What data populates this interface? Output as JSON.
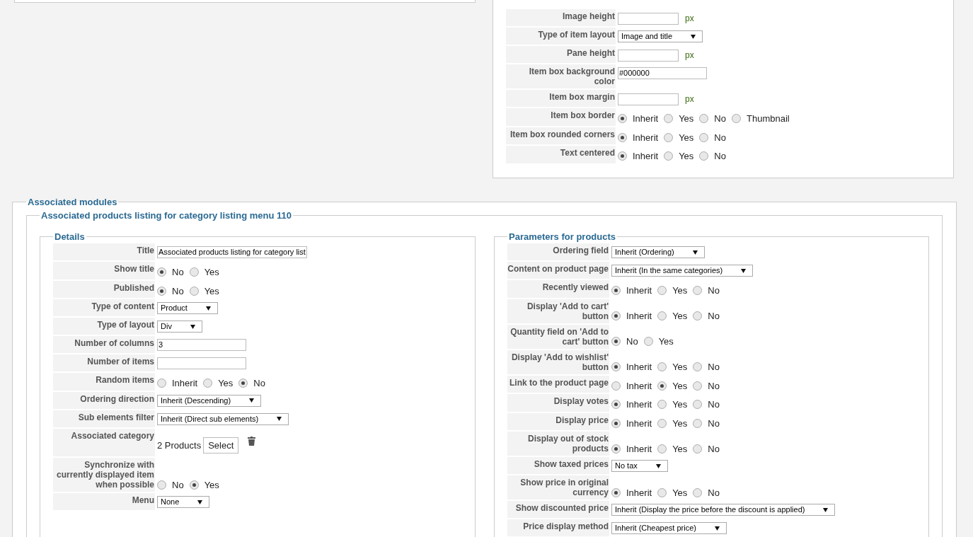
{
  "top_panel": {
    "rows": [
      {
        "kind": "text",
        "label": "Image height",
        "value": "",
        "unit": "px"
      },
      {
        "kind": "select",
        "label": "Type of item layout",
        "value": "Image and title"
      },
      {
        "kind": "text",
        "label": "Pane height",
        "value": "",
        "unit": "px"
      },
      {
        "kind": "text",
        "label": "Item box background color",
        "value": "#000000"
      },
      {
        "kind": "text",
        "label": "Item box margin",
        "value": "",
        "unit": "px"
      },
      {
        "kind": "radio",
        "label": "Item box border",
        "options": [
          {
            "label": "Inherit",
            "selected": true
          },
          {
            "label": "Yes",
            "selected": false
          },
          {
            "label": "No",
            "selected": false
          },
          {
            "label": "Thumbnail",
            "selected": false
          }
        ]
      },
      {
        "kind": "radio",
        "label": "Item box rounded corners",
        "options": [
          {
            "label": "Inherit",
            "selected": true
          },
          {
            "label": "Yes",
            "selected": false
          },
          {
            "label": "No",
            "selected": false
          }
        ]
      },
      {
        "kind": "radio",
        "label": "Text centered",
        "options": [
          {
            "label": "Inherit",
            "selected": true
          },
          {
            "label": "Yes",
            "selected": false
          },
          {
            "label": "No",
            "selected": false
          }
        ]
      }
    ]
  },
  "associated_modules": {
    "legend": "Associated modules",
    "module": {
      "legend": "Associated products listing for category listing menu 110",
      "details": {
        "legend": "Details",
        "rows": [
          {
            "kind": "text",
            "label": "Title",
            "value": "Associated products listing for category list"
          },
          {
            "kind": "radio",
            "label": "Show title",
            "options": [
              {
                "label": "No",
                "selected": true
              },
              {
                "label": "Yes",
                "selected": false
              }
            ]
          },
          {
            "kind": "radio",
            "label": "Published",
            "options": [
              {
                "label": "No",
                "selected": true
              },
              {
                "label": "Yes",
                "selected": false
              }
            ]
          },
          {
            "kind": "select",
            "label": "Type of content",
            "value": "Product"
          },
          {
            "kind": "select",
            "label": "Type of layout",
            "value": "Div"
          },
          {
            "kind": "text",
            "label": "Number of columns",
            "value": "3"
          },
          {
            "kind": "text",
            "label": "Number of items",
            "value": ""
          },
          {
            "kind": "radio",
            "label": "Random items",
            "options": [
              {
                "label": "Inherit",
                "selected": false
              },
              {
                "label": "Yes",
                "selected": false
              },
              {
                "label": "No",
                "selected": true
              }
            ]
          },
          {
            "kind": "select",
            "label": "Ordering direction",
            "value": "Inherit (Descending)"
          },
          {
            "kind": "select",
            "label": "Sub elements filter",
            "value": "Inherit (Direct sub elements)"
          },
          {
            "kind": "category",
            "label": "Associated category",
            "count": "2 Products",
            "button": "Select"
          },
          {
            "kind": "radio",
            "label": "Synchronize with currently displayed item when possible",
            "options": [
              {
                "label": "No",
                "selected": false
              },
              {
                "label": "Yes",
                "selected": true
              }
            ]
          },
          {
            "kind": "select",
            "label": "Menu",
            "value": "None"
          }
        ]
      },
      "parameters": {
        "legend": "Parameters for products",
        "rows": [
          {
            "kind": "select",
            "label": "Ordering field",
            "value": "Inherit (Ordering)"
          },
          {
            "kind": "select",
            "label": "Content on product page",
            "value": "Inherit (In the same categories)"
          },
          {
            "kind": "radio",
            "label": "Recently viewed",
            "options": [
              {
                "label": "Inherit",
                "selected": true
              },
              {
                "label": "Yes",
                "selected": false
              },
              {
                "label": "No",
                "selected": false
              }
            ]
          },
          {
            "kind": "radio",
            "label": "Display 'Add to cart' button",
            "options": [
              {
                "label": "Inherit",
                "selected": true
              },
              {
                "label": "Yes",
                "selected": false
              },
              {
                "label": "No",
                "selected": false
              }
            ]
          },
          {
            "kind": "radio",
            "label": "Quantity field on 'Add to cart' button",
            "options": [
              {
                "label": "No",
                "selected": true
              },
              {
                "label": "Yes",
                "selected": false
              }
            ]
          },
          {
            "kind": "radio",
            "label": "Display 'Add to wishlist' button",
            "options": [
              {
                "label": "Inherit",
                "selected": true
              },
              {
                "label": "Yes",
                "selected": false
              },
              {
                "label": "No",
                "selected": false
              }
            ]
          },
          {
            "kind": "radio",
            "label": "Link to the product page",
            "options": [
              {
                "label": "Inherit",
                "selected": false
              },
              {
                "label": "Yes",
                "selected": true
              },
              {
                "label": "No",
                "selected": false
              }
            ]
          },
          {
            "kind": "radio",
            "label": "Display votes",
            "options": [
              {
                "label": "Inherit",
                "selected": true
              },
              {
                "label": "Yes",
                "selected": false
              },
              {
                "label": "No",
                "selected": false
              }
            ]
          },
          {
            "kind": "radio",
            "label": "Display price",
            "options": [
              {
                "label": "Inherit",
                "selected": true
              },
              {
                "label": "Yes",
                "selected": false
              },
              {
                "label": "No",
                "selected": false
              }
            ]
          },
          {
            "kind": "radio",
            "label": "Display out of stock products",
            "options": [
              {
                "label": "Inherit",
                "selected": true
              },
              {
                "label": "Yes",
                "selected": false
              },
              {
                "label": "No",
                "selected": false
              }
            ]
          },
          {
            "kind": "select",
            "label": "Show taxed prices",
            "value": "No tax"
          },
          {
            "kind": "radio",
            "label": "Show price in original currency",
            "options": [
              {
                "label": "Inherit",
                "selected": true
              },
              {
                "label": "Yes",
                "selected": false
              },
              {
                "label": "No",
                "selected": false
              }
            ]
          },
          {
            "kind": "select",
            "label": "Show discounted price",
            "value": "Inherit (Display the price before the discount is applied)"
          },
          {
            "kind": "select",
            "label": "Price display method",
            "value": "Inherit (Cheapest price)"
          }
        ]
      }
    }
  }
}
